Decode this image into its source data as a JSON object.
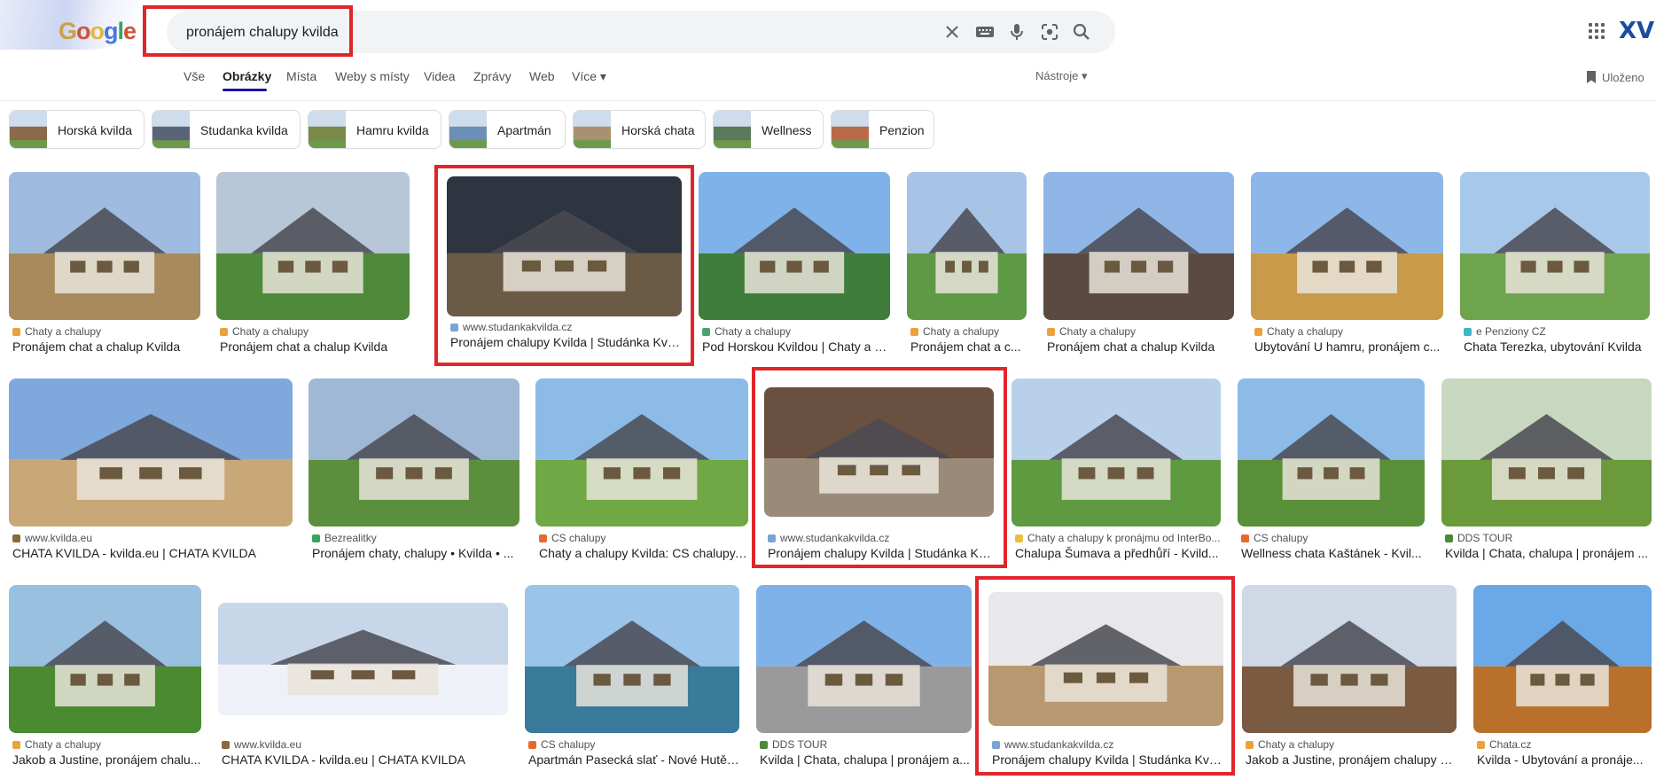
{
  "logo": {
    "letters": [
      "G",
      "o",
      "o",
      "g",
      "l",
      "e"
    ]
  },
  "search": {
    "query": "pronájem chalupy kvilda"
  },
  "icons": {
    "clear": "close-icon",
    "keyboard": "keyboard-icon",
    "mic": "microphone-icon",
    "lens": "lens-icon",
    "search": "search-icon",
    "apps": "apps-grid-icon",
    "saved": "bookmark-icon"
  },
  "header": {
    "avatar_text": "XV"
  },
  "tabs": [
    {
      "label": "Vše"
    },
    {
      "label": "Obrázky",
      "active": true
    },
    {
      "label": "Místa"
    },
    {
      "label": "Weby s místy"
    },
    {
      "label": "Videa"
    },
    {
      "label": "Zprávy"
    },
    {
      "label": "Web"
    },
    {
      "label": "Více ▾"
    }
  ],
  "tools_label": "Nástroje ▾",
  "saved_label": "Uloženo",
  "chips": [
    {
      "label": "Horská kvilda",
      "color": "#8a6a4a"
    },
    {
      "label": "Studanka kvilda",
      "color": "#5a6478"
    },
    {
      "label": "Hamru kvilda",
      "color": "#7a8a4a"
    },
    {
      "label": "Apartmán",
      "color": "#6b8fb8"
    },
    {
      "label": "Horská chata",
      "color": "#a89070"
    },
    {
      "label": "Wellness",
      "color": "#5a7a5a"
    },
    {
      "label": "Penzion",
      "color": "#b86a4a"
    }
  ],
  "results": [
    {
      "source": "Chaty a chalupy",
      "title": "Pronájem chat a chalup Kvilda",
      "src_color": "#e8a33d",
      "c1": "#9fbbe0",
      "c2": "#a88a5c"
    },
    {
      "source": "Chaty a chalupy",
      "title": "Pronájem chat a chalup Kvilda",
      "src_color": "#e8a33d",
      "c1": "#b7c7d8",
      "c2": "#4f8a3a"
    },
    {
      "source": "www.studankakvilda.cz",
      "title": "Pronájem chalupy Kvilda | Studánka Kvil...",
      "src_color": "#7aa3d6",
      "c1": "#2e3440",
      "c2": "#6b5a45"
    },
    {
      "source": "Chaty a chalupy",
      "title": "Pod Horskou Kvildou | Chaty a c...",
      "src_color": "#4aa36a",
      "c1": "#7fb2e8",
      "c2": "#3f7d3a"
    },
    {
      "source": "Chaty a chalupy",
      "title": "Pronájem chat a c...",
      "src_color": "#e8a33d",
      "c1": "#a7c4e6",
      "c2": "#5e9a45"
    },
    {
      "source": "Chaty a chalupy",
      "title": "Pronájem chat a chalup Kvilda",
      "src_color": "#e8a33d",
      "c1": "#8fb6e6",
      "c2": "#5a4a40"
    },
    {
      "source": "Chaty a chalupy",
      "title": "Ubytování U hamru, pronájem c...",
      "src_color": "#e8a33d",
      "c1": "#8cb7e8",
      "c2": "#c89a4a"
    },
    {
      "source": "e Penziony CZ",
      "title": "Chata Terezka, ubytování Kvilda",
      "src_color": "#3db5c8",
      "c1": "#a8c8ea",
      "c2": "#6fa44e"
    },
    {
      "source": "www.kvilda.eu",
      "title": "CHATA KVILDA - kvilda.eu | CHATA KVILDA",
      "src_color": "#8a6a3a",
      "c1": "#7fa8dc",
      "c2": "#c9a878"
    },
    {
      "source": "Bezrealitky",
      "title": "Pronájem chaty, chalupy • Kvilda • ...",
      "src_color": "#3aa35b",
      "c1": "#9fb8d6",
      "c2": "#5b8f3d"
    },
    {
      "source": "CS chalupy",
      "title": "Chaty a chalupy Kvilda: CS chalupy,...",
      "src_color": "#e86a2a",
      "c1": "#8cbbe8",
      "c2": "#6fa845"
    },
    {
      "source": "www.studankakvilda.cz",
      "title": "Pronájem chalupy Kvilda | Studánka Kv...",
      "src_color": "#7aa3d6",
      "c1": "#6a5040",
      "c2": "#9a8a78"
    },
    {
      "source": "Chaty a chalupy k pronájmu od InterBo...",
      "title": "Chalupa Šumava a předhůří - Kvild...",
      "src_color": "#e8c03d",
      "c1": "#b8d0ea",
      "c2": "#5e9a40"
    },
    {
      "source": "CS chalupy",
      "title": "Wellness chata Kaštánek - Kvil...",
      "src_color": "#e86a2a",
      "c1": "#8cbbe8",
      "c2": "#5a8f3a"
    },
    {
      "source": "DDS TOUR",
      "title": "Kvilda | Chata, chalupa | pronájem ...",
      "src_color": "#4a8a3a",
      "c1": "#c8d8c0",
      "c2": "#6a9a3a"
    },
    {
      "source": "Chaty a chalupy",
      "title": "Jakob a Justine, pronájem chalu...",
      "src_color": "#e8a33d",
      "c1": "#9ac0e0",
      "c2": "#4a8a30"
    },
    {
      "source": "www.kvilda.eu",
      "title": "CHATA KVILDA - kvilda.eu | CHATA KVILDA",
      "src_color": "#8a6a3a",
      "c1": "#c8d6ea",
      "c2": "#eef2f8"
    },
    {
      "source": "CS chalupy",
      "title": "Apartmán Pasecká slať - Nové Hutě ...",
      "src_color": "#e86a2a",
      "c1": "#9ac4ea",
      "c2": "#3a7a9a"
    },
    {
      "source": "DDS TOUR",
      "title": "Kvilda | Chata, chalupa | pronájem a...",
      "src_color": "#4a8a3a",
      "c1": "#7fb2e8",
      "c2": "#9a9a9a"
    },
    {
      "source": "www.studankakvilda.cz",
      "title": "Pronájem chalupy Kvilda | Studánka Kvilda",
      "src_color": "#7aa3d6",
      "c1": "#e8e8ea",
      "c2": "#b89870"
    },
    {
      "source": "Chaty a chalupy",
      "title": "Jakob a Justine, pronájem chalupy K...",
      "src_color": "#e8a33d",
      "c1": "#cfd9e6",
      "c2": "#7a5a40"
    },
    {
      "source": "Chata.cz",
      "title": "Kvilda - Ubytování a pronáje...",
      "src_color": "#e8a33d",
      "c1": "#6aa8e8",
      "c2": "#b8702a"
    }
  ]
}
